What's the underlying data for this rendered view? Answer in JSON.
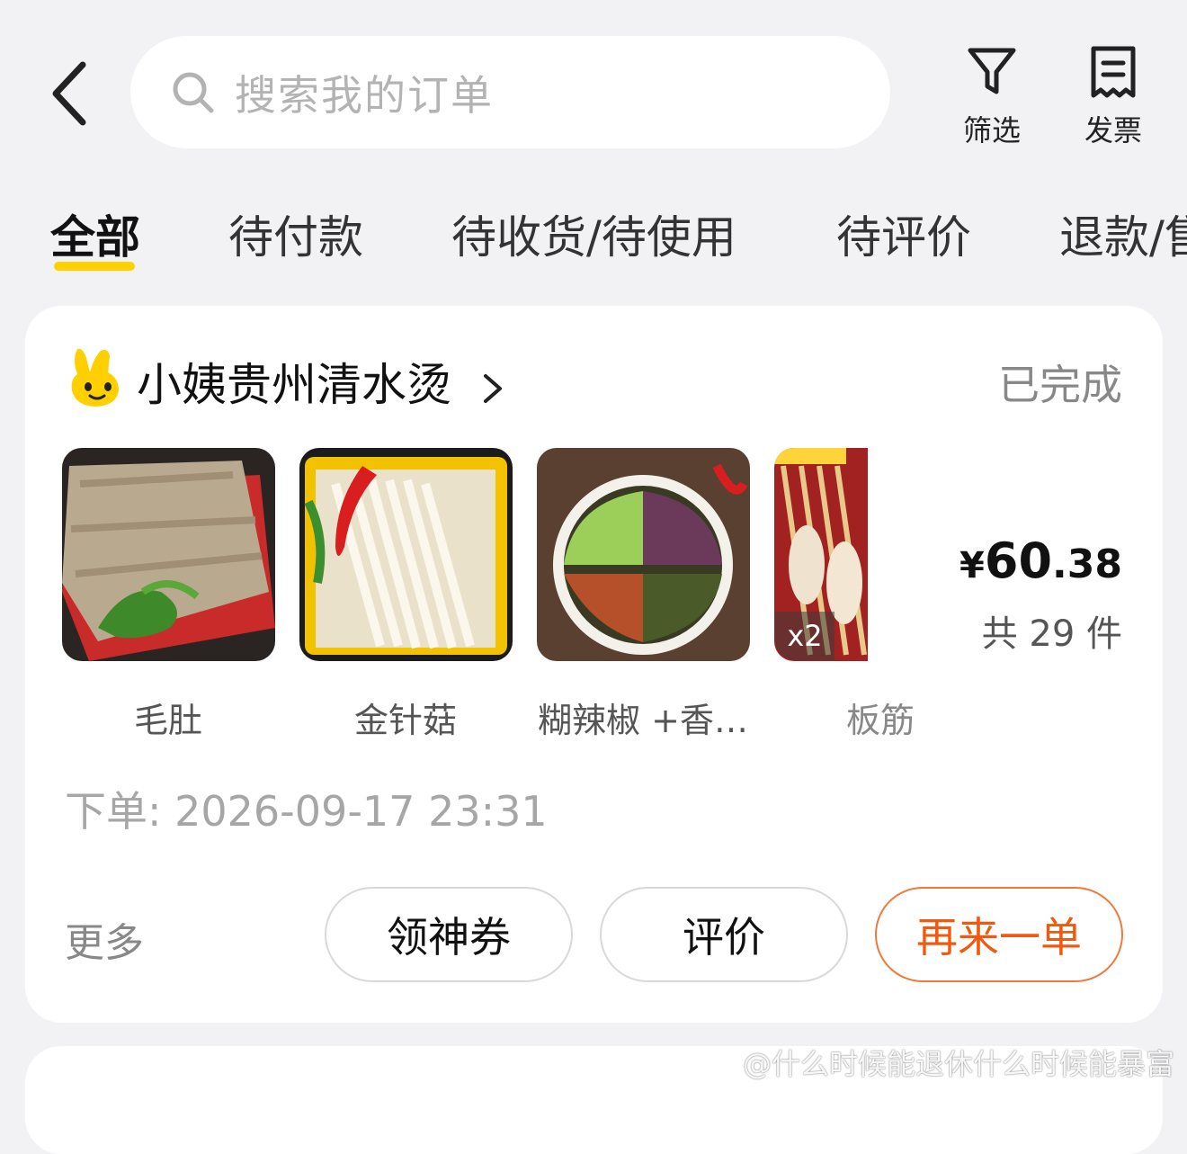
{
  "header": {
    "search_placeholder": "搜索我的订单",
    "filter_label": "筛选",
    "invoice_label": "发票"
  },
  "tabs": [
    {
      "label": "全部",
      "active": true
    },
    {
      "label": "待付款"
    },
    {
      "label": "待收货/待使用"
    },
    {
      "label": "待评价"
    },
    {
      "label": "退款/售"
    }
  ],
  "order": {
    "store_name": "小姨贵州清水烫",
    "status": "已完成",
    "items": [
      {
        "name": "毛肚"
      },
      {
        "name": "金针菇"
      },
      {
        "name": "糊辣椒 +香…"
      },
      {
        "name": "板筋",
        "quantity_badge": "x2"
      }
    ],
    "price_symbol": "¥",
    "price_int": "60",
    "price_dec": ".38",
    "item_count": "共 29 件",
    "order_time": "下单: 2026-09-17 23:31",
    "actions": {
      "more": "更多",
      "coupon": "领神券",
      "review": "评价",
      "reorder": "再来一单"
    }
  },
  "watermark": "@什么时候能退休什么时候能暴富",
  "colors": {
    "accent_yellow": "#ffd100",
    "reorder_orange": "#ef5a10",
    "background": "#f2f2f5"
  }
}
